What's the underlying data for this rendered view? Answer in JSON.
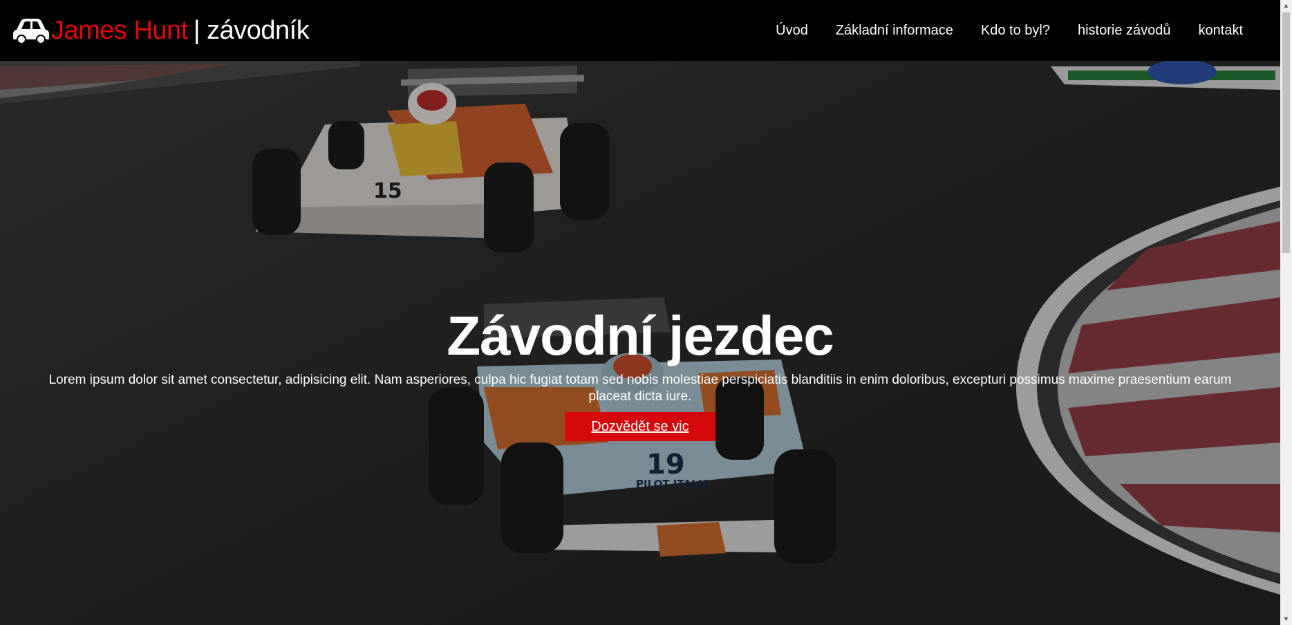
{
  "brand": {
    "name": "James Hunt",
    "separator": "|",
    "role": "závodník",
    "icon": "car-icon",
    "name_color": "#e0070b"
  },
  "nav": {
    "items": [
      {
        "label": "Úvod"
      },
      {
        "label": "Základní informace"
      },
      {
        "label": "Kdo to byl?"
      },
      {
        "label": "historie závodů"
      },
      {
        "label": "kontakt"
      }
    ]
  },
  "hero": {
    "title": "Závodní jezdec",
    "text": "Lorem ipsum dolor sit amet consectetur, adipisicing elit. Nam asperiores, culpa hic fugiat totam sed nobis molestiae perspiciatis blanditiis in enim doloribus, excepturi possimus maxime praesentium earum placeat dicta iure.",
    "button_label": "Dozvědět se vic",
    "button_color": "#d4070b",
    "background_image": "race-cars-on-track-photo"
  },
  "cars": {
    "back_number": "15",
    "front_number": "19",
    "front_sponsor": "PILOT ITALIA"
  }
}
